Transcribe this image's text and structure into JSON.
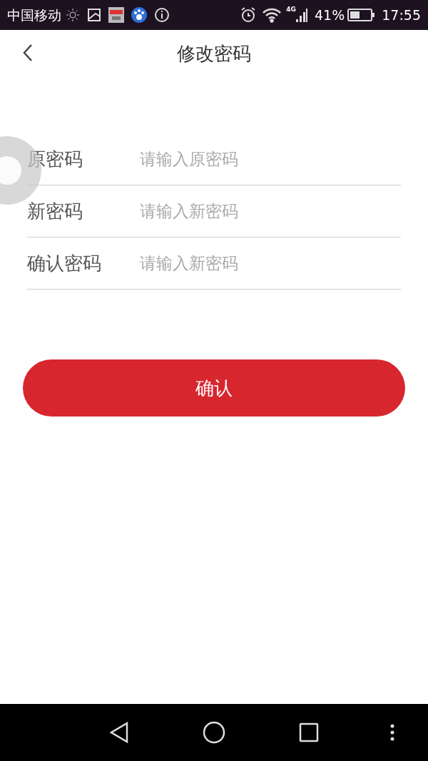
{
  "status_bar": {
    "carrier": "中国移动",
    "network": "4G",
    "battery": "41%",
    "time": "17:55"
  },
  "header": {
    "title": "修改密码"
  },
  "fields": [
    {
      "label": "原密码",
      "placeholder": "请输入原密码"
    },
    {
      "label": "新密码",
      "placeholder": "请输入新密码"
    },
    {
      "label": "确认密码",
      "placeholder": "请输入新密码"
    }
  ],
  "submit": {
    "label": "确认"
  }
}
